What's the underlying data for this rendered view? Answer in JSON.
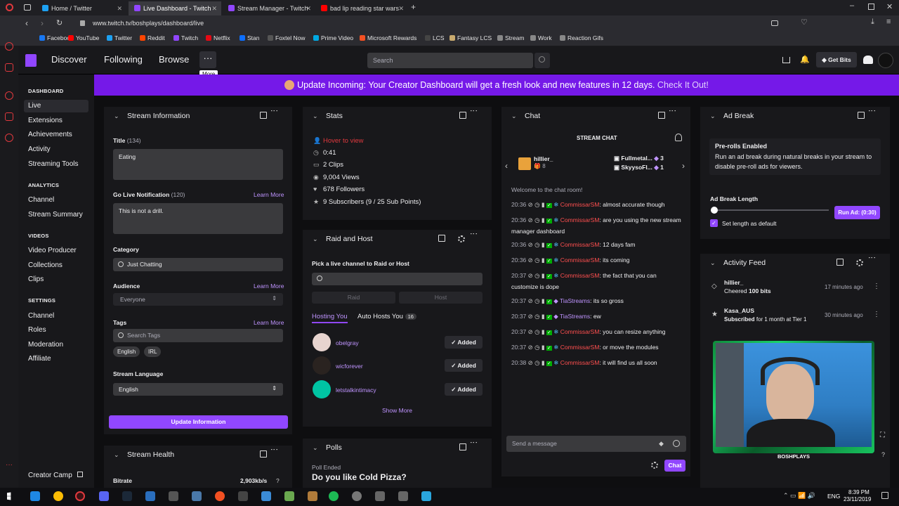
{
  "browser": {
    "tabs": [
      {
        "label": "Home / Twitter",
        "color": "#1da1f2"
      },
      {
        "label": "Live Dashboard - Twitch",
        "color": "#9146ff"
      },
      {
        "label": "Stream Manager - Twitch",
        "color": "#9146ff"
      },
      {
        "label": "bad lip reading star wars",
        "color": "#ff0000"
      }
    ],
    "url": "www.twitch.tv/boshplays/dashboard/live",
    "bookmarks": [
      {
        "label": "Facebook",
        "color": "#1877f2"
      },
      {
        "label": "YouTube",
        "color": "#ff0000"
      },
      {
        "label": "Twitter",
        "color": "#1da1f2"
      },
      {
        "label": "Reddit",
        "color": "#ff4500"
      },
      {
        "label": "Twitch",
        "color": "#9146ff"
      },
      {
        "label": "Netflix",
        "color": "#e50914"
      },
      {
        "label": "Stan",
        "color": "#0d6efd"
      },
      {
        "label": "Foxtel Now",
        "color": "#555"
      },
      {
        "label": "Prime Video",
        "color": "#00a8e1"
      },
      {
        "label": "Microsoft Rewards",
        "color": "#f25022"
      },
      {
        "label": "LCS",
        "color": "#444"
      },
      {
        "label": "Fantasy LCS",
        "color": "#c8aa6e"
      },
      {
        "label": "Stream",
        "color": "#888"
      },
      {
        "label": "Work",
        "color": "#888"
      },
      {
        "label": "Reaction Gifs",
        "color": "#888"
      }
    ]
  },
  "topnav": {
    "discover": "Discover",
    "following": "Following",
    "browse": "Browse",
    "more_tooltip": "More",
    "search_placeholder": "Search",
    "get_bits": "Get Bits"
  },
  "banner": {
    "text": "Update Incoming: Your Creator Dashboard will get a fresh look and new features in 12 days.",
    "link": "Check It Out!"
  },
  "sidebar": {
    "dashboard": "DASHBOARD",
    "live": "Live",
    "extensions": "Extensions",
    "achievements": "Achievements",
    "activity": "Activity",
    "streaming_tools": "Streaming Tools",
    "analytics": "ANALYTICS",
    "channel": "Channel",
    "stream_summary": "Stream Summary",
    "videos": "VIDEOS",
    "video_producer": "Video Producer",
    "collections": "Collections",
    "clips": "Clips",
    "settings": "SETTINGS",
    "s_channel": "Channel",
    "roles": "Roles",
    "moderation": "Moderation",
    "affiliate": "Affiliate",
    "creator_camp": "Creator Camp"
  },
  "stream_info": {
    "header": "Stream Information",
    "title_label": "Title",
    "title_count": "(134)",
    "title_value": "Eating",
    "golive_label": "Go Live Notification",
    "golive_count": "(120)",
    "golive_value": "This is not a drill.",
    "learn_more": "Learn More",
    "category_label": "Category",
    "category_value": "Just Chatting",
    "audience_label": "Audience",
    "audience_value": "Everyone",
    "tags_label": "Tags",
    "tags_placeholder": "Search Tags",
    "tags": [
      "English",
      "IRL"
    ],
    "language_label": "Stream Language",
    "language_value": "English",
    "update_button": "Update Information"
  },
  "stream_health": {
    "header": "Stream Health",
    "bitrate_label": "Bitrate",
    "bitrate_value": "2,903kb/s"
  },
  "stats": {
    "header": "Stats",
    "rows": [
      "Hover to view",
      "0:41",
      "2 Clips",
      "9,004 Views",
      "678 Followers",
      "9 Subscribers (9 / 25 Sub Points)"
    ]
  },
  "raid": {
    "header": "Raid and Host",
    "prompt": "Pick a live channel to Raid or Host",
    "raid": "Raid",
    "host": "Host",
    "tab_hosting": "Hosting You",
    "tab_autohost": "Auto Hosts You",
    "autohost_count": "16",
    "hosts": [
      {
        "name": "obelgray",
        "status": "Added"
      },
      {
        "name": "wicforever",
        "status": "Added"
      },
      {
        "name": "letstalkintimacy",
        "status": "Added"
      }
    ],
    "show_more": "Show More"
  },
  "polls": {
    "header": "Polls",
    "status": "Poll Ended",
    "question": "Do you like Cold Pizza?"
  },
  "chat": {
    "header": "Chat",
    "stream_chat": "STREAM CHAT",
    "gifter": {
      "name": "hillier_",
      "count": "8"
    },
    "top": [
      {
        "name": "Fullmetal...",
        "count": "3"
      },
      {
        "name": "SkyysoFl...",
        "count": "1"
      }
    ],
    "welcome": "Welcome to the chat room!",
    "messages": [
      {
        "time": "20:36",
        "user": "CommissarSM",
        "text": "almost accurate though"
      },
      {
        "time": "20:36",
        "user": "CommissarSM",
        "text": "are you using the new stream manager dashboard"
      },
      {
        "time": "20:36",
        "user": "CommissarSM",
        "text": "12 days fam"
      },
      {
        "time": "20:36",
        "user": "CommissarSM",
        "text": "its coming"
      },
      {
        "time": "20:37",
        "user": "CommissarSM",
        "text": "the fact that you can customize is dope"
      },
      {
        "time": "20:37",
        "user": "TiaStreams",
        "text": "its so gross"
      },
      {
        "time": "20:37",
        "user": "TiaStreams",
        "text": "ew"
      },
      {
        "time": "20:37",
        "user": "CommissarSM",
        "text": "you can resize anything"
      },
      {
        "time": "20:37",
        "user": "CommissarSM",
        "text": "or move the modules"
      },
      {
        "time": "20:38",
        "user": "CommissarSM",
        "text": "it will find us all soon"
      }
    ],
    "input_placeholder": "Send a message",
    "send": "Chat"
  },
  "ad_break": {
    "header": "Ad Break",
    "title": "Pre-rolls Enabled",
    "desc": "Run an ad break during natural breaks in your stream to disable pre-roll ads for viewers.",
    "length_label": "Ad Break Length",
    "run_button": "Run Ad: (0:30)",
    "default_label": "Set length as default",
    "slider_level": 0
  },
  "activity": {
    "header": "Activity Feed",
    "items": [
      {
        "user": "hillier_",
        "action": "Cheered",
        "detail": "100 bits",
        "time": "17 minutes ago"
      },
      {
        "user": "Kasa_AUS",
        "action": "Subscribed",
        "detail": "for 1 month at Tier 1",
        "time": "30 minutes ago"
      }
    ],
    "webcam_label": "BOSHPLAYS"
  },
  "taskbar": {
    "lang": "ENG",
    "time": "8:39 PM",
    "date": "23/11/2019"
  }
}
